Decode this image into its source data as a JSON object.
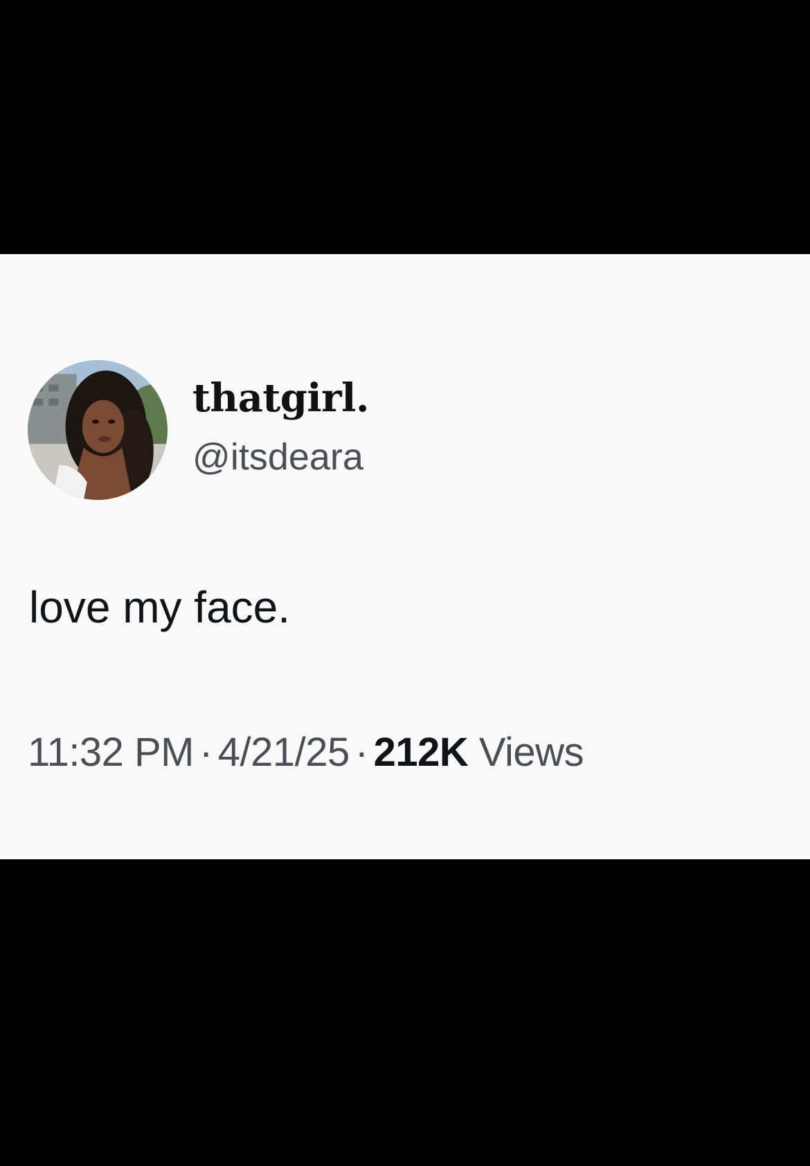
{
  "tweet": {
    "display_name": "thatgirl.",
    "handle": "@itsdeara",
    "text": "love my face.",
    "time": "11:32 PM",
    "separator": "·",
    "date": "4/21/25",
    "views_count": "212K",
    "views_label": "Views"
  },
  "colors": {
    "background": "#000000",
    "card": "#f9f9f9",
    "primary_text": "#0f1419",
    "secondary_text": "#4a4f55"
  },
  "avatar": {
    "icon": "profile-photo"
  }
}
